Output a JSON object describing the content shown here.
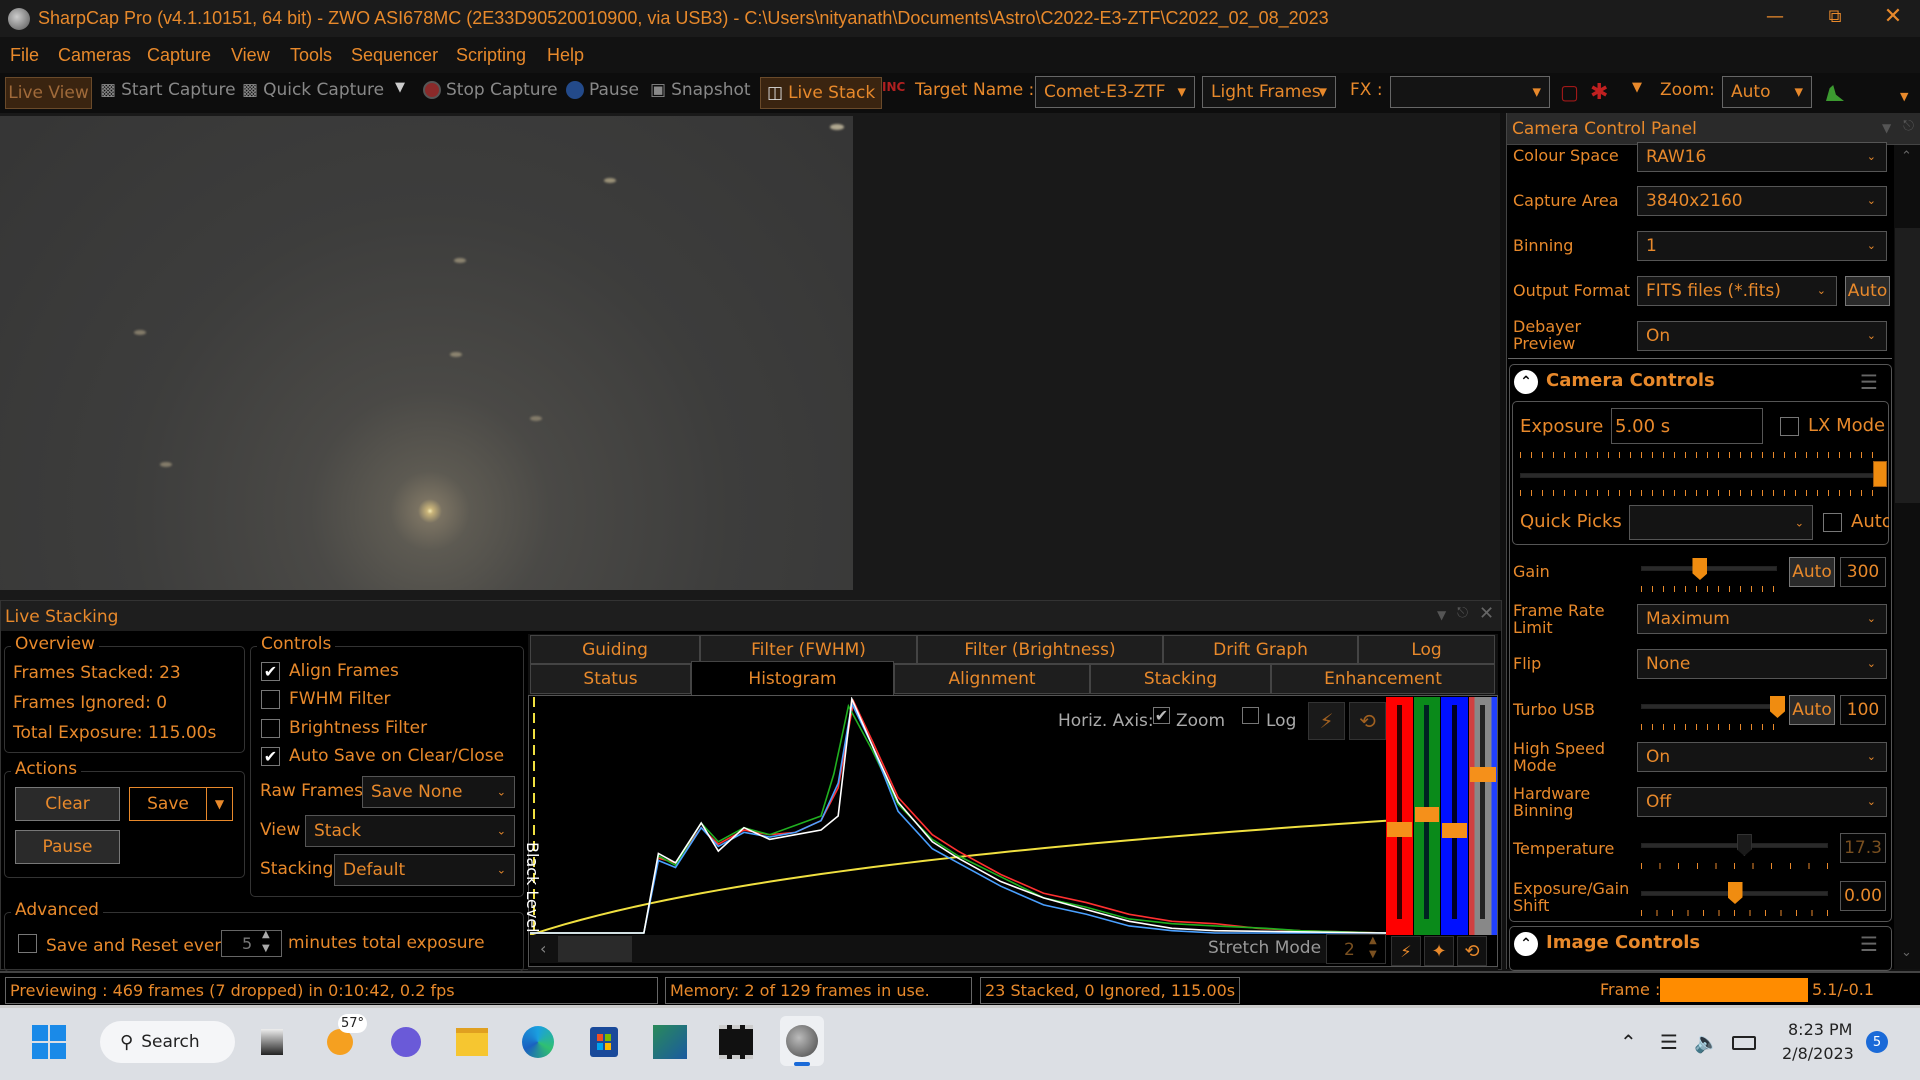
{
  "window": {
    "title": "SharpCap Pro (v4.1.10151, 64 bit) - ZWO ASI678MC (2E33D90520010900, via USB3) - C:\\Users\\nityanath\\Documents\\Astro\\C2022-E3-ZTF\\C2022_02_08_2023"
  },
  "menu": [
    "File",
    "Cameras",
    "Capture",
    "View",
    "Tools",
    "Sequencer",
    "Scripting",
    "Help"
  ],
  "toolbar": {
    "live_view": "Live View",
    "start_capture": "Start Capture",
    "quick_capture": "Quick Capture",
    "stop_capture": "Stop Capture",
    "pause": "Pause",
    "snapshot": "Snapshot",
    "live_stack": "Live Stack",
    "target_label": "Target Name :",
    "target_value": "Comet-E3-ZTF",
    "frame_type": "Light Frames",
    "fx_label": "FX :",
    "fx_value": "",
    "zoom_label": "Zoom:",
    "zoom_value": "Auto"
  },
  "camera_panel": {
    "title": "Camera Control Panel",
    "rows": [
      {
        "label": "Colour Space",
        "value": "RAW16"
      },
      {
        "label": "Capture Area",
        "value": "3840x2160"
      },
      {
        "label": "Binning",
        "value": "1"
      },
      {
        "label": "Output Format",
        "value": "FITS files (*.fits)",
        "button": "Auto"
      },
      {
        "label": "Debayer Preview",
        "value": "On"
      }
    ],
    "camera_controls": {
      "title": "Camera Controls",
      "exposure_label": "Exposure",
      "exposure_value": "5.00 s",
      "lx_mode": "LX Mode",
      "lx_checked": false,
      "exposure_slider": 1.0,
      "quick_picks_label": "Quick Picks",
      "quick_picks_value": "",
      "quick_auto": "Auto",
      "gain": {
        "label": "Gain",
        "auto": "Auto",
        "value": "300",
        "fraction": 0.43
      },
      "frame_rate": {
        "label": "Frame Rate Limit",
        "value": "Maximum"
      },
      "flip": {
        "label": "Flip",
        "value": "None"
      },
      "turbo": {
        "label": "Turbo USB",
        "auto": "Auto",
        "value": "100",
        "fraction": 1.0
      },
      "high_speed": {
        "label": "High Speed Mode",
        "value": "On"
      },
      "hw_binning": {
        "label": "Hardware Binning",
        "value": "Off"
      },
      "temperature": {
        "label": "Temperature",
        "value": "17.3",
        "fraction": 0.55
      },
      "shift": {
        "label": "Exposure/Gain Shift",
        "value": "0.00",
        "fraction": 0.5
      }
    },
    "image_controls": {
      "title": "Image Controls"
    }
  },
  "live_stacking": {
    "title": "Live Stacking",
    "overview": {
      "title": "Overview",
      "frames_stacked": "Frames Stacked: 23",
      "frames_ignored": "Frames Ignored: 0",
      "total_exposure_label": "Total Exposure:",
      "total_exposure": "115.00s"
    },
    "actions": {
      "title": "Actions",
      "clear": "Clear",
      "save": "Save",
      "pause": "Pause"
    },
    "controls": {
      "title": "Controls",
      "checks": [
        {
          "label": "Align Frames",
          "checked": true
        },
        {
          "label": "FWHM Filter",
          "checked": false
        },
        {
          "label": "Brightness Filter",
          "checked": false
        },
        {
          "label": "Auto Save on Clear/Close",
          "checked": true
        }
      ],
      "raw_frames_label": "Raw Frames",
      "raw_frames": "Save None",
      "view_label": "View",
      "view": "Stack",
      "stacking_label": "Stacking",
      "stacking": "Default"
    },
    "advanced": {
      "title": "Advanced",
      "save_reset": "Save and Reset every",
      "minutes": "5",
      "suffix": "minutes total exposure"
    },
    "tabs_row1": [
      "Guiding",
      "Filter (FWHM)",
      "Filter (Brightness)",
      "Drift Graph",
      "Log"
    ],
    "tabs_row2": [
      "Status",
      "Histogram",
      "Alignment",
      "Stacking",
      "Enhancement"
    ],
    "active_tab": "Histogram",
    "histogram": {
      "horiz_axis": "Horiz. Axis:",
      "zoom": "Zoom",
      "zoom_checked": true,
      "log": "Log",
      "log_checked": false,
      "black_level": "Black Level",
      "stretch_mode_label": "Stretch Mode :",
      "stretch_mode": "2",
      "series": [
        {
          "color": "#ff3030",
          "points": [
            [
              0,
              0
            ],
            [
              0.133,
              0
            ],
            [
              0.15,
              0.32
            ],
            [
              0.17,
              0.3
            ],
            [
              0.2,
              0.45
            ],
            [
              0.22,
              0.38
            ],
            [
              0.25,
              0.44
            ],
            [
              0.28,
              0.42
            ],
            [
              0.31,
              0.43
            ],
            [
              0.34,
              0.48
            ],
            [
              0.36,
              0.62
            ],
            [
              0.378,
              0.99
            ],
            [
              0.4,
              0.82
            ],
            [
              0.43,
              0.58
            ],
            [
              0.47,
              0.42
            ],
            [
              0.5,
              0.35
            ],
            [
              0.55,
              0.25
            ],
            [
              0.6,
              0.17
            ],
            [
              0.65,
              0.13
            ],
            [
              0.7,
              0.08
            ],
            [
              0.75,
              0.05
            ],
            [
              0.8,
              0.04
            ],
            [
              0.85,
              0.02
            ],
            [
              0.9,
              0.01
            ],
            [
              1,
              0
            ]
          ]
        },
        {
          "color": "#20b020",
          "points": [
            [
              0,
              0
            ],
            [
              0.133,
              0
            ],
            [
              0.15,
              0.33
            ],
            [
              0.17,
              0.29
            ],
            [
              0.2,
              0.47
            ],
            [
              0.22,
              0.39
            ],
            [
              0.25,
              0.45
            ],
            [
              0.28,
              0.42
            ],
            [
              0.31,
              0.46
            ],
            [
              0.34,
              0.5
            ],
            [
              0.355,
              0.68
            ],
            [
              0.372,
              0.97
            ],
            [
              0.4,
              0.78
            ],
            [
              0.43,
              0.55
            ],
            [
              0.47,
              0.4
            ],
            [
              0.5,
              0.33
            ],
            [
              0.55,
              0.24
            ],
            [
              0.6,
              0.15
            ],
            [
              0.65,
              0.11
            ],
            [
              0.7,
              0.06
            ],
            [
              0.75,
              0.04
            ],
            [
              0.8,
              0.03
            ],
            [
              0.86,
              0.02
            ],
            [
              0.9,
              0.01
            ],
            [
              1,
              0
            ]
          ]
        },
        {
          "color": "#4aa0ff",
          "points": [
            [
              0,
              0
            ],
            [
              0.133,
              0
            ],
            [
              0.15,
              0.31
            ],
            [
              0.17,
              0.28
            ],
            [
              0.2,
              0.45
            ],
            [
              0.22,
              0.37
            ],
            [
              0.25,
              0.43
            ],
            [
              0.28,
              0.41
            ],
            [
              0.31,
              0.43
            ],
            [
              0.34,
              0.48
            ],
            [
              0.36,
              0.64
            ],
            [
              0.376,
              0.98
            ],
            [
              0.4,
              0.8
            ],
            [
              0.43,
              0.52
            ],
            [
              0.47,
              0.36
            ],
            [
              0.5,
              0.3
            ],
            [
              0.55,
              0.2
            ],
            [
              0.6,
              0.12
            ],
            [
              0.65,
              0.08
            ],
            [
              0.7,
              0.03
            ],
            [
              0.75,
              0.01
            ],
            [
              0.8,
              0
            ],
            [
              1,
              0
            ]
          ]
        },
        {
          "color": "#ffffff",
          "points": [
            [
              0,
              0
            ],
            [
              0.133,
              0
            ],
            [
              0.15,
              0.34
            ],
            [
              0.17,
              0.3
            ],
            [
              0.2,
              0.47
            ],
            [
              0.22,
              0.35
            ],
            [
              0.25,
              0.45
            ],
            [
              0.28,
              0.4
            ],
            [
              0.31,
              0.42
            ],
            [
              0.34,
              0.44
            ],
            [
              0.36,
              0.5
            ],
            [
              0.376,
              1.0
            ],
            [
              0.4,
              0.8
            ],
            [
              0.43,
              0.56
            ],
            [
              0.47,
              0.39
            ],
            [
              0.5,
              0.32
            ],
            [
              0.55,
              0.22
            ],
            [
              0.6,
              0.15
            ],
            [
              0.65,
              0.1
            ],
            [
              0.7,
              0.05
            ],
            [
              0.75,
              0.02
            ],
            [
              0.8,
              0.01
            ],
            [
              1,
              0
            ]
          ]
        }
      ],
      "transfer_curve": {
        "color": "#f0e040",
        "end_level": 0.48
      }
    }
  },
  "statusbar": {
    "preview": "Previewing : 469 frames (7 dropped) in 0:10:42, 0.2 fps",
    "memory": "Memory: 2 of 129 frames in use.",
    "stacked": "23 Stacked, 0 Ignored, 115.00s",
    "frame_label": "Frame :",
    "frame_value": "5.1/-0.1"
  },
  "taskbar": {
    "search": "Search",
    "weather": "57°",
    "time": "8:23 PM",
    "date": "2/8/2023",
    "notifications": "5"
  },
  "colors": {
    "accent": "#e8892b",
    "slider_thumb": "#f08c10"
  }
}
